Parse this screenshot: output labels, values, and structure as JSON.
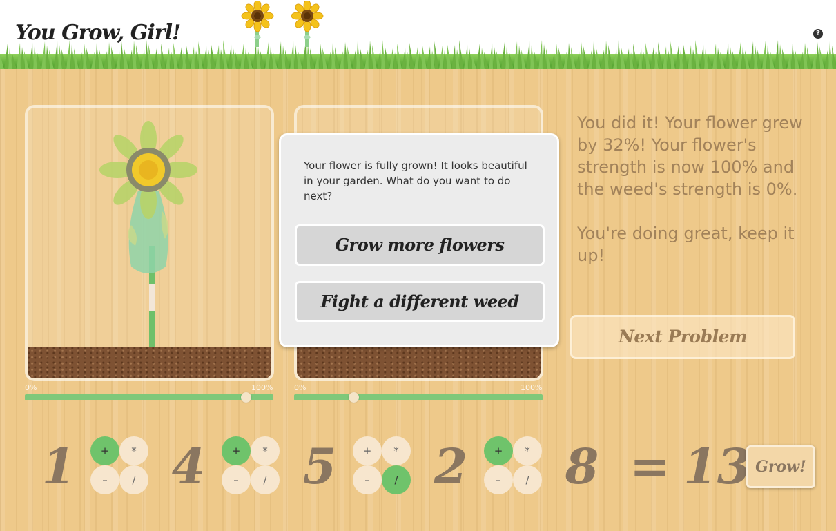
{
  "header": {
    "title": "You Grow, Girl!",
    "help_icon": "?"
  },
  "panels": {
    "left": {
      "min_label": "0%",
      "max_label": "100%",
      "level": 0.89
    },
    "right": {
      "min_label": "0%",
      "max_label": "100%",
      "level": 0.24
    }
  },
  "modal": {
    "message": "Your flower is fully grown! It looks beautiful in your garden. What do you want to do next?",
    "option1": "Grow more flowers",
    "option2": "Fight a different weed"
  },
  "feedback": {
    "line1": "You did it! Your flower grew by 32%! Your flower's strength is now 100% and the weed's strength is 0%.",
    "line2": "You're doing great, keep it up!"
  },
  "next_button": "Next Problem",
  "equation": {
    "numbers": [
      "1",
      "4",
      "5",
      "2",
      "8"
    ],
    "equals": "=",
    "result": "13",
    "operator_groups": [
      {
        "plus": "+",
        "times": "*",
        "minus": "–",
        "divide": "/",
        "selected": "plus"
      },
      {
        "plus": "+",
        "times": "*",
        "minus": "–",
        "divide": "/",
        "selected": "plus"
      },
      {
        "plus": "+",
        "times": "*",
        "minus": "–",
        "divide": "/",
        "selected": "divide"
      },
      {
        "plus": "+",
        "times": "*",
        "minus": "–",
        "divide": "/",
        "selected": "plus"
      }
    ]
  },
  "grow_button": "Grow!",
  "colors": {
    "wood": "#eec98a",
    "grass": "#6bb240",
    "slider_green": "#7fc87a",
    "selected_operator": "#6fc36b",
    "text_brown": "#8a7660"
  }
}
